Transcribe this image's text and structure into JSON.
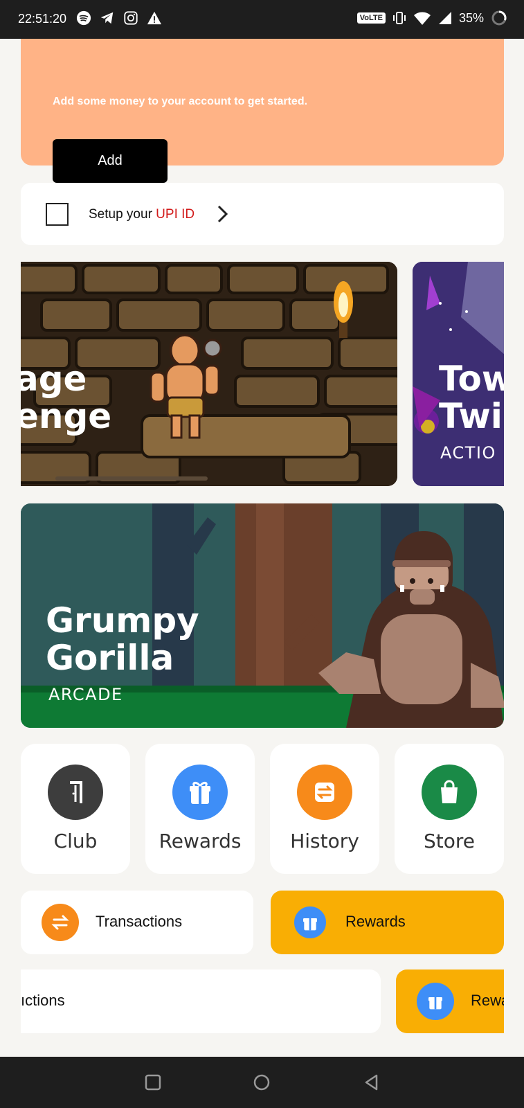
{
  "status_bar": {
    "time": "22:51:20",
    "network": "VoLTE",
    "battery": "35%"
  },
  "wallet": {
    "message": "Add some money to your account to get started.",
    "add_label": "Add"
  },
  "upi": {
    "prefix": "Setup your ",
    "highlight": "UPI ID"
  },
  "banners": [
    {
      "title_line1": "age",
      "title_line2": "enge"
    },
    {
      "title_line1": "Tow",
      "title_line2": "Twi",
      "category": "ACTIO"
    },
    {
      "title_line1": "Grumpy",
      "title_line2": "Gorilla",
      "category": "ARCADE"
    }
  ],
  "quick_links": [
    {
      "label": "Club",
      "icon": "club-door-icon",
      "color": "#3d3d3d"
    },
    {
      "label": "Rewards",
      "icon": "gift-icon",
      "color": "#3e8ef7"
    },
    {
      "label": "History",
      "icon": "exchange-icon",
      "color": "#f78a1a"
    },
    {
      "label": "Store",
      "icon": "shopping-bag-icon",
      "color": "#1a8a47"
    }
  ],
  "chips_row1": [
    {
      "label": "Transactions",
      "icon": "exchange-icon",
      "bg": "#ffffff",
      "icon_color": "#f78a1a"
    },
    {
      "label": "Rewards",
      "icon": "gift-icon",
      "bg": "#f9ae04",
      "icon_color": "#3e8ef7"
    }
  ],
  "chips_row2": [
    {
      "label": "ıctions",
      "icon": "exchange-icon",
      "bg": "#ffffff"
    },
    {
      "label": "Rewa",
      "icon": "gift-icon",
      "bg": "#f9ae04",
      "icon_color": "#3e8ef7"
    }
  ]
}
